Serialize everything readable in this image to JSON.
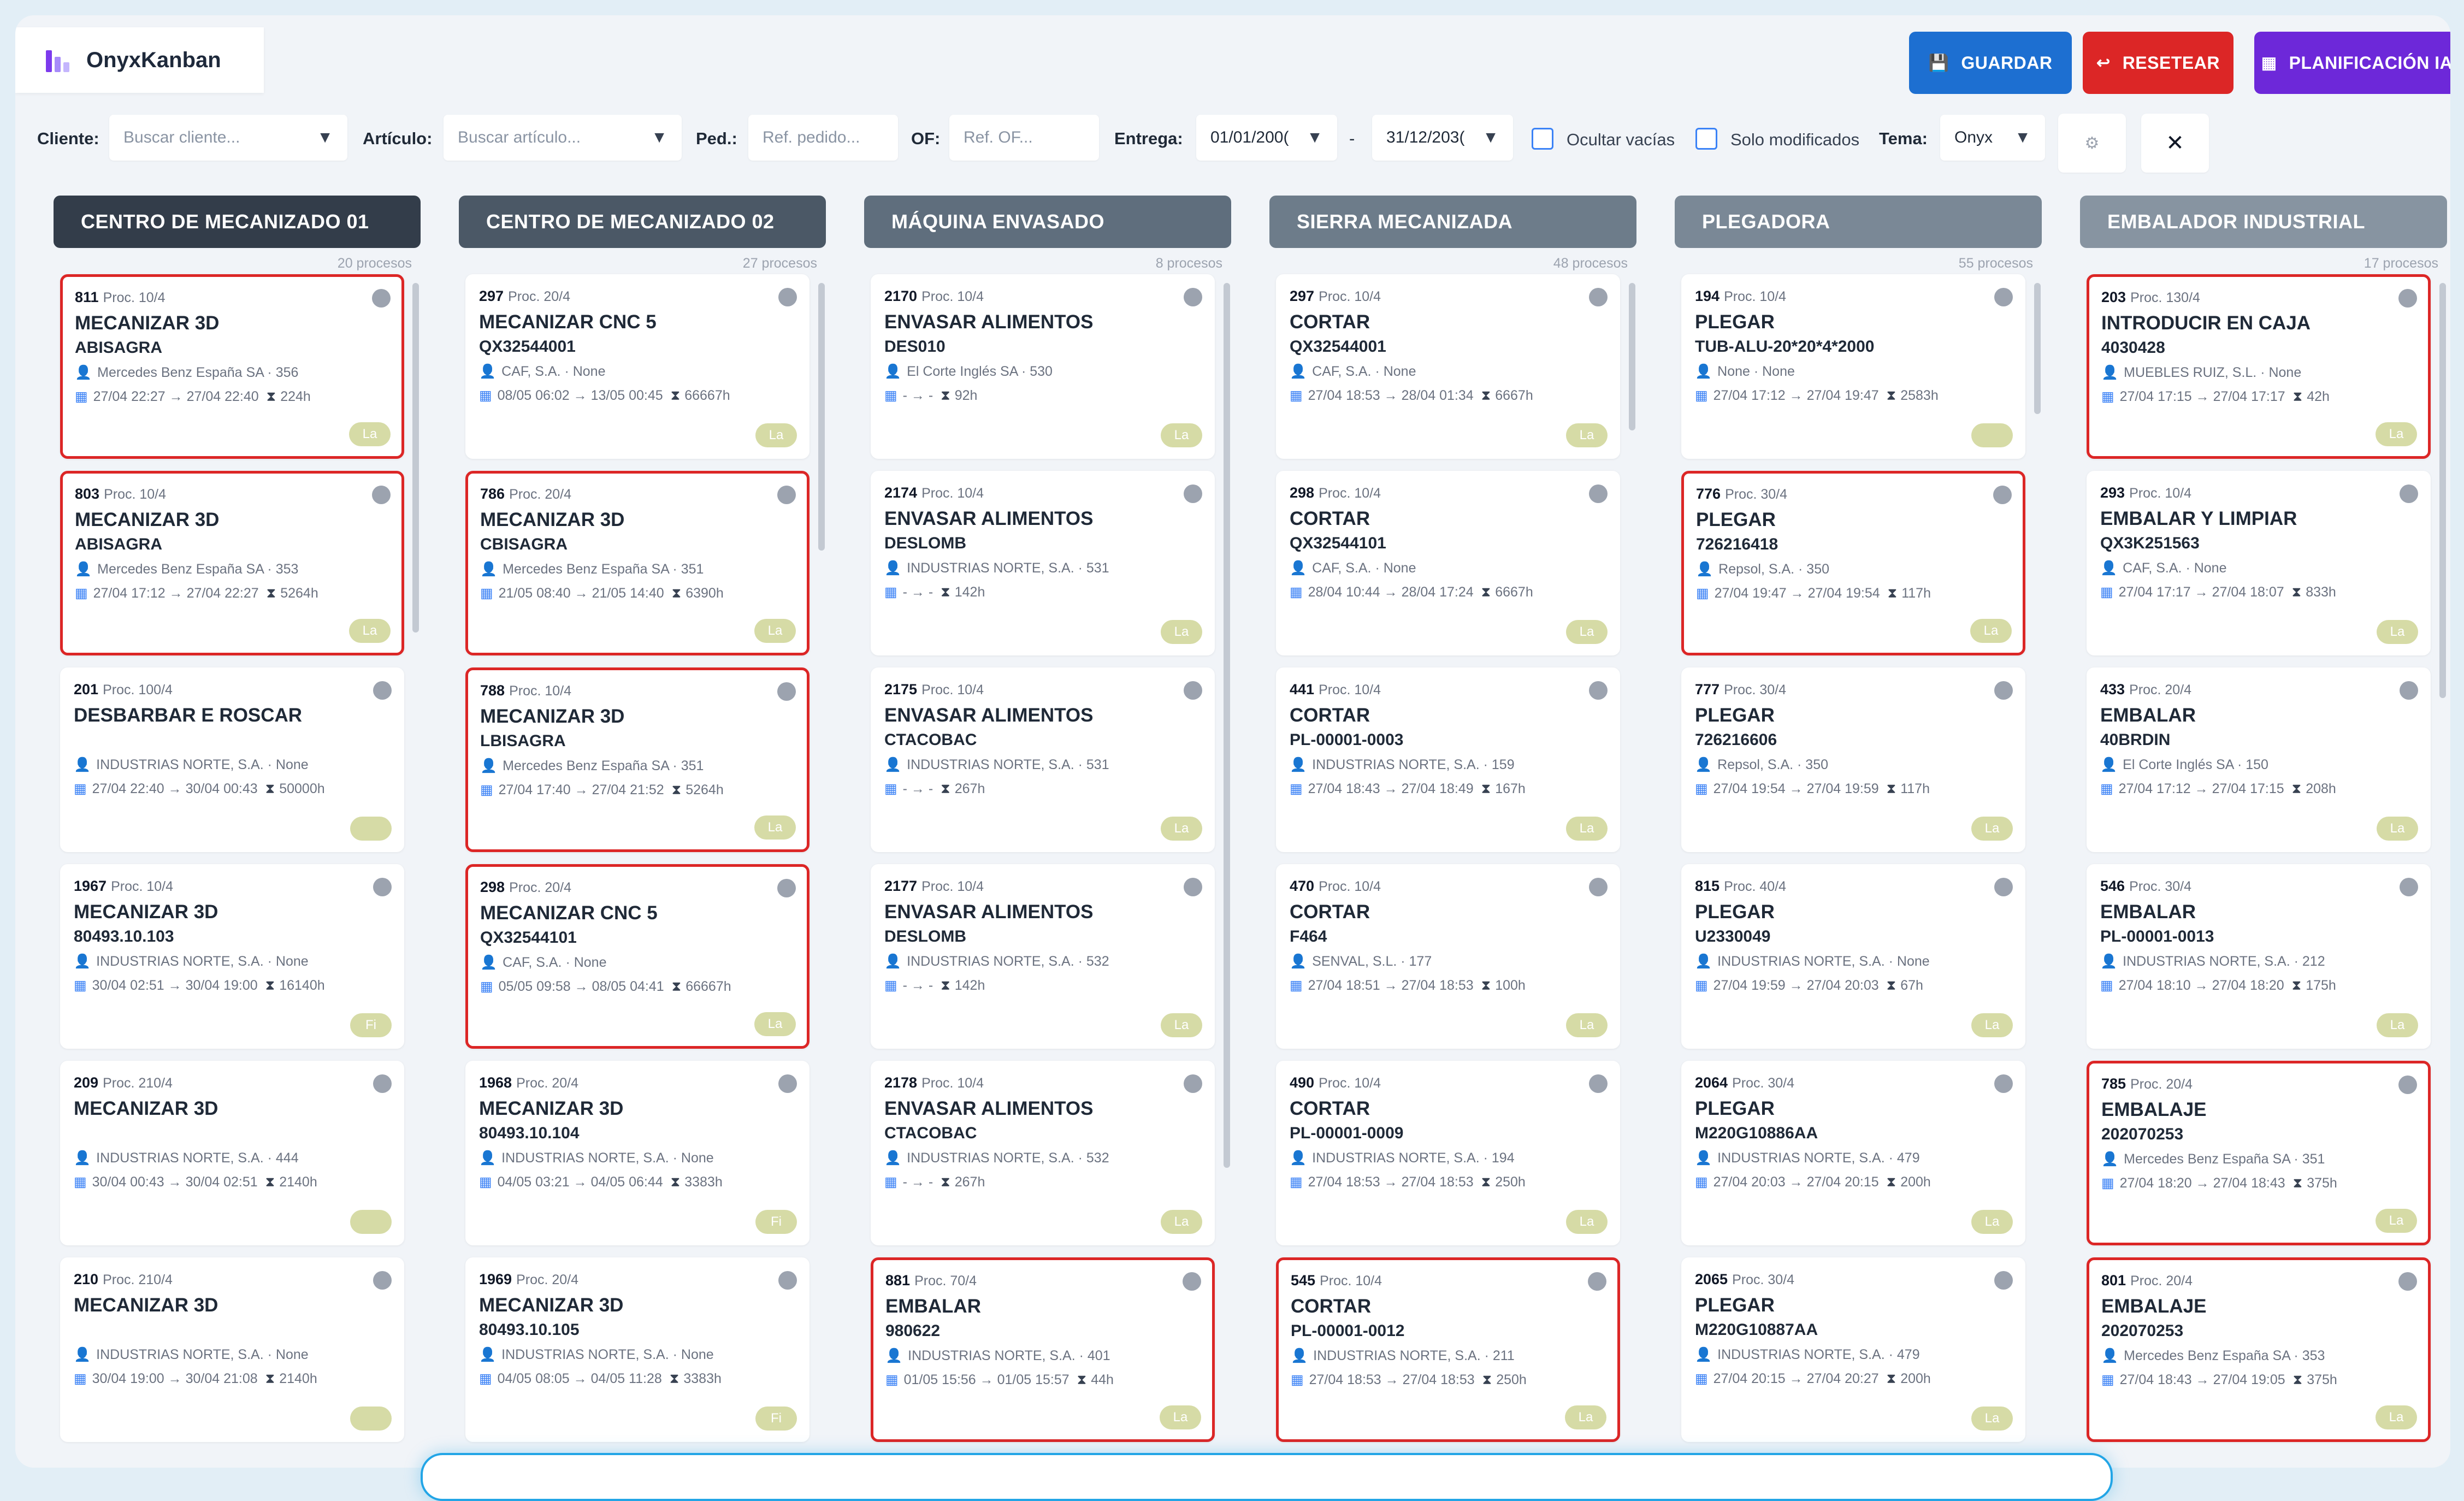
{
  "brand": {
    "name": "OnyxKanban",
    "icon": "chart-bars-icon"
  },
  "actions": {
    "save": {
      "label": "GUARDAR",
      "icon": "save-icon"
    },
    "reset": {
      "label": "RESETEAR",
      "icon": "undo-icon"
    },
    "plan": {
      "label": "PLANIFICACIÓN IA",
      "icon": "calendar-icon"
    }
  },
  "filters": {
    "cliente": {
      "label": "Cliente:",
      "placeholder": "Buscar cliente..."
    },
    "articulo": {
      "label": "Artículo:",
      "placeholder": "Buscar artículo..."
    },
    "pedido": {
      "label": "Ped.:",
      "placeholder": "Ref. pedido..."
    },
    "of": {
      "label": "OF:",
      "placeholder": "Ref. OF..."
    },
    "entrega": {
      "label": "Entrega:",
      "from": "01/01/200(",
      "sep": "-",
      "to": "31/12/203("
    },
    "ocultar": "Ocultar vacías",
    "solo": "Solo modificados",
    "tema": {
      "label": "Tema:",
      "value": "Onyx"
    },
    "close": "✕"
  },
  "colors": {
    "accent": "#1d6fd1",
    "danger": "#dc2626",
    "purple": "#6d28d9",
    "flag": "#dc2626"
  },
  "columns": [
    {
      "title": "CENTRO DE MECANIZADO 01",
      "count": "20 procesos",
      "color": "#333d4a",
      "cards": [
        {
          "id": "811",
          "proc": "Proc. 10/4",
          "op": "MECANIZAR 3D",
          "ref": "ABISAGRA",
          "cust": "Mercedes Benz España SA · 356",
          "dates": "27/04 22:27 → 27/04 22:40",
          "hrs": "224h",
          "tag": "La",
          "flag": true
        },
        {
          "id": "803",
          "proc": "Proc. 10/4",
          "op": "MECANIZAR 3D",
          "ref": "ABISAGRA",
          "cust": "Mercedes Benz España SA · 353",
          "dates": "27/04 17:12 → 27/04 22:27",
          "hrs": "5264h",
          "tag": "La",
          "flag": true
        },
        {
          "id": "201",
          "proc": "Proc. 100/4",
          "op": "DESBARBAR E ROSCAR",
          "ref": "",
          "cust": "INDUSTRIAS NORTE, S.A. · None",
          "dates": "27/04 22:40 → 30/04 00:43",
          "hrs": "50000h",
          "tag": "",
          "flag": false
        },
        {
          "id": "1967",
          "proc": "Proc. 10/4",
          "op": "MECANIZAR 3D",
          "ref": "80493.10.103",
          "cust": "INDUSTRIAS NORTE, S.A. · None",
          "dates": "30/04 02:51 → 30/04 19:00",
          "hrs": "16140h",
          "tag": "Fi",
          "flag": false
        },
        {
          "id": "209",
          "proc": "Proc. 210/4",
          "op": "MECANIZAR 3D",
          "ref": "",
          "cust": "INDUSTRIAS NORTE, S.A. · 444",
          "dates": "30/04 00:43 → 30/04 02:51",
          "hrs": "2140h",
          "tag": "",
          "flag": false
        },
        {
          "id": "210",
          "proc": "Proc. 210/4",
          "op": "MECANIZAR 3D",
          "ref": "",
          "cust": "INDUSTRIAS NORTE, S.A. · None",
          "dates": "30/04 19:00 → 30/04 21:08",
          "hrs": "2140h",
          "tag": "",
          "flag": false
        }
      ]
    },
    {
      "title": "CENTRO DE MECANIZADO 02",
      "count": "27 procesos",
      "color": "#4b5866",
      "cards": [
        {
          "id": "297",
          "proc": "Proc. 20/4",
          "op": "MECANIZAR CNC 5",
          "ref": "QX32544001",
          "cust": "CAF, S.A. · None",
          "dates": "08/05 06:02 → 13/05 00:45",
          "hrs": "66667h",
          "tag": "La",
          "flag": false
        },
        {
          "id": "786",
          "proc": "Proc. 20/4",
          "op": "MECANIZAR 3D",
          "ref": "CBISAGRA",
          "cust": "Mercedes Benz España SA · 351",
          "dates": "21/05 08:40 → 21/05 14:40",
          "hrs": "6390h",
          "tag": "La",
          "flag": true
        },
        {
          "id": "788",
          "proc": "Proc. 10/4",
          "op": "MECANIZAR 3D",
          "ref": "LBISAGRA",
          "cust": "Mercedes Benz España SA · 351",
          "dates": "27/04 17:40 → 27/04 21:52",
          "hrs": "5264h",
          "tag": "La",
          "flag": true
        },
        {
          "id": "298",
          "proc": "Proc. 20/4",
          "op": "MECANIZAR CNC 5",
          "ref": "QX32544101",
          "cust": "CAF, S.A. · None",
          "dates": "05/05 09:58 → 08/05 04:41",
          "hrs": "66667h",
          "tag": "La",
          "flag": true
        },
        {
          "id": "1968",
          "proc": "Proc. 20/4",
          "op": "MECANIZAR 3D",
          "ref": "80493.10.104",
          "cust": "INDUSTRIAS NORTE, S.A. · None",
          "dates": "04/05 03:21 → 04/05 06:44",
          "hrs": "3383h",
          "tag": "Fi",
          "flag": false
        },
        {
          "id": "1969",
          "proc": "Proc. 20/4",
          "op": "MECANIZAR 3D",
          "ref": "80493.10.105",
          "cust": "INDUSTRIAS NORTE, S.A. · None",
          "dates": "04/05 08:05 → 04/05 11:28",
          "hrs": "3383h",
          "tag": "Fi",
          "flag": false
        }
      ]
    },
    {
      "title": "MÁQUINA ENVASADO",
      "count": "8 procesos",
      "color": "#5f6e7d",
      "cards": [
        {
          "id": "2170",
          "proc": "Proc. 10/4",
          "op": "ENVASAR ALIMENTOS",
          "ref": "DES010",
          "cust": "El Corte Inglés SA · 530",
          "dates": "- → -",
          "hrs": "92h",
          "tag": "La",
          "flag": false
        },
        {
          "id": "2174",
          "proc": "Proc. 10/4",
          "op": "ENVASAR ALIMENTOS",
          "ref": "DESLOMB",
          "cust": "INDUSTRIAS NORTE, S.A. · 531",
          "dates": "- → -",
          "hrs": "142h",
          "tag": "La",
          "flag": false
        },
        {
          "id": "2175",
          "proc": "Proc. 10/4",
          "op": "ENVASAR ALIMENTOS",
          "ref": "CTACOBAC",
          "cust": "INDUSTRIAS NORTE, S.A. · 531",
          "dates": "- → -",
          "hrs": "267h",
          "tag": "La",
          "flag": false
        },
        {
          "id": "2177",
          "proc": "Proc. 10/4",
          "op": "ENVASAR ALIMENTOS",
          "ref": "DESLOMB",
          "cust": "INDUSTRIAS NORTE, S.A. · 532",
          "dates": "- → -",
          "hrs": "142h",
          "tag": "La",
          "flag": false
        },
        {
          "id": "2178",
          "proc": "Proc. 10/4",
          "op": "ENVASAR ALIMENTOS",
          "ref": "CTACOBAC",
          "cust": "INDUSTRIAS NORTE, S.A. · 532",
          "dates": "- → -",
          "hrs": "267h",
          "tag": "La",
          "flag": false
        },
        {
          "id": "881",
          "proc": "Proc. 70/4",
          "op": "EMBALAR",
          "ref": "980622",
          "cust": "INDUSTRIAS NORTE, S.A. · 401",
          "dates": "01/05 15:56 → 01/05 15:57",
          "hrs": "44h",
          "tag": "La",
          "flag": true
        }
      ]
    },
    {
      "title": "SIERRA MECANIZADA",
      "count": "48 procesos",
      "color": "#6d7c8a",
      "cards": [
        {
          "id": "297",
          "proc": "Proc. 10/4",
          "op": "CORTAR",
          "ref": "QX32544001",
          "cust": "CAF, S.A. · None",
          "dates": "27/04 18:53 → 28/04 01:34",
          "hrs": "6667h",
          "tag": "La",
          "flag": false
        },
        {
          "id": "298",
          "proc": "Proc. 10/4",
          "op": "CORTAR",
          "ref": "QX32544101",
          "cust": "CAF, S.A. · None",
          "dates": "28/04 10:44 → 28/04 17:24",
          "hrs": "6667h",
          "tag": "La",
          "flag": false
        },
        {
          "id": "441",
          "proc": "Proc. 10/4",
          "op": "CORTAR",
          "ref": "PL-00001-0003",
          "cust": "INDUSTRIAS NORTE, S.A. · 159",
          "dates": "27/04 18:43 → 27/04 18:49",
          "hrs": "167h",
          "tag": "La",
          "flag": false
        },
        {
          "id": "470",
          "proc": "Proc. 10/4",
          "op": "CORTAR",
          "ref": "F464",
          "cust": "SENVAL, S.L. · 177",
          "dates": "27/04 18:51 → 27/04 18:53",
          "hrs": "100h",
          "tag": "La",
          "flag": false
        },
        {
          "id": "490",
          "proc": "Proc. 10/4",
          "op": "CORTAR",
          "ref": "PL-00001-0009",
          "cust": "INDUSTRIAS NORTE, S.A. · 194",
          "dates": "27/04 18:53 → 27/04 18:53",
          "hrs": "250h",
          "tag": "La",
          "flag": false
        },
        {
          "id": "545",
          "proc": "Proc. 10/4",
          "op": "CORTAR",
          "ref": "PL-00001-0012",
          "cust": "INDUSTRIAS NORTE, S.A. · 211",
          "dates": "27/04 18:53 → 27/04 18:53",
          "hrs": "250h",
          "tag": "La",
          "flag": true
        }
      ]
    },
    {
      "title": "PLEGADORA",
      "count": "55 procesos",
      "color": "#7a8896",
      "cards": [
        {
          "id": "194",
          "proc": "Proc. 10/4",
          "op": "PLEGAR",
          "ref": "TUB-ALU-20*20*4*2000",
          "cust": "None · None",
          "dates": "27/04 17:12 → 27/04 19:47",
          "hrs": "2583h",
          "tag": "",
          "flag": false
        },
        {
          "id": "776",
          "proc": "Proc. 30/4",
          "op": "PLEGAR",
          "ref": "726216418",
          "cust": "Repsol, S.A. · 350",
          "dates": "27/04 19:47 → 27/04 19:54",
          "hrs": "117h",
          "tag": "La",
          "flag": true
        },
        {
          "id": "777",
          "proc": "Proc. 30/4",
          "op": "PLEGAR",
          "ref": "726216606",
          "cust": "Repsol, S.A. · 350",
          "dates": "27/04 19:54 → 27/04 19:59",
          "hrs": "117h",
          "tag": "La",
          "flag": false
        },
        {
          "id": "815",
          "proc": "Proc. 40/4",
          "op": "PLEGAR",
          "ref": "U2330049",
          "cust": "INDUSTRIAS NORTE, S.A. · None",
          "dates": "27/04 19:59 → 27/04 20:03",
          "hrs": "67h",
          "tag": "La",
          "flag": false
        },
        {
          "id": "2064",
          "proc": "Proc. 30/4",
          "op": "PLEGAR",
          "ref": "M220G10886AA",
          "cust": "INDUSTRIAS NORTE, S.A. · 479",
          "dates": "27/04 20:03 → 27/04 20:15",
          "hrs": "200h",
          "tag": "La",
          "flag": false
        },
        {
          "id": "2065",
          "proc": "Proc. 30/4",
          "op": "PLEGAR",
          "ref": "M220G10887AA",
          "cust": "INDUSTRIAS NORTE, S.A. · 479",
          "dates": "27/04 20:15 → 27/04 20:27",
          "hrs": "200h",
          "tag": "La",
          "flag": false
        }
      ]
    },
    {
      "title": "EMBALADOR INDUSTRIAL",
      "count": "17 procesos",
      "color": "#8794a1",
      "cards": [
        {
          "id": "203",
          "proc": "Proc. 130/4",
          "op": "INTRODUCIR EN CAJA",
          "ref": "4030428",
          "cust": "MUEBLES RUIZ, S.L. · None",
          "dates": "27/04 17:15 → 27/04 17:17",
          "hrs": "42h",
          "tag": "La",
          "flag": true
        },
        {
          "id": "293",
          "proc": "Proc. 10/4",
          "op": "EMBALAR Y LIMPIAR",
          "ref": "QX3K251563",
          "cust": "CAF, S.A. · None",
          "dates": "27/04 17:17 → 27/04 18:07",
          "hrs": "833h",
          "tag": "La",
          "flag": false
        },
        {
          "id": "433",
          "proc": "Proc. 20/4",
          "op": "EMBALAR",
          "ref": "40BRDIN",
          "cust": "El Corte Inglés SA · 150",
          "dates": "27/04 17:12 → 27/04 17:15",
          "hrs": "208h",
          "tag": "La",
          "flag": false
        },
        {
          "id": "546",
          "proc": "Proc. 30/4",
          "op": "EMBALAR",
          "ref": "PL-00001-0013",
          "cust": "INDUSTRIAS NORTE, S.A. · 212",
          "dates": "27/04 18:10 → 27/04 18:20",
          "hrs": "175h",
          "tag": "La",
          "flag": false
        },
        {
          "id": "785",
          "proc": "Proc. 20/4",
          "op": "EMBALAJE",
          "ref": "202070253",
          "cust": "Mercedes Benz España SA · 351",
          "dates": "27/04 18:20 → 27/04 18:43",
          "hrs": "375h",
          "tag": "La",
          "flag": true
        },
        {
          "id": "801",
          "proc": "Proc. 20/4",
          "op": "EMBALAJE",
          "ref": "202070253",
          "cust": "Mercedes Benz España SA · 353",
          "dates": "27/04 18:43 → 27/04 19:05",
          "hrs": "375h",
          "tag": "La",
          "flag": true
        }
      ]
    }
  ]
}
